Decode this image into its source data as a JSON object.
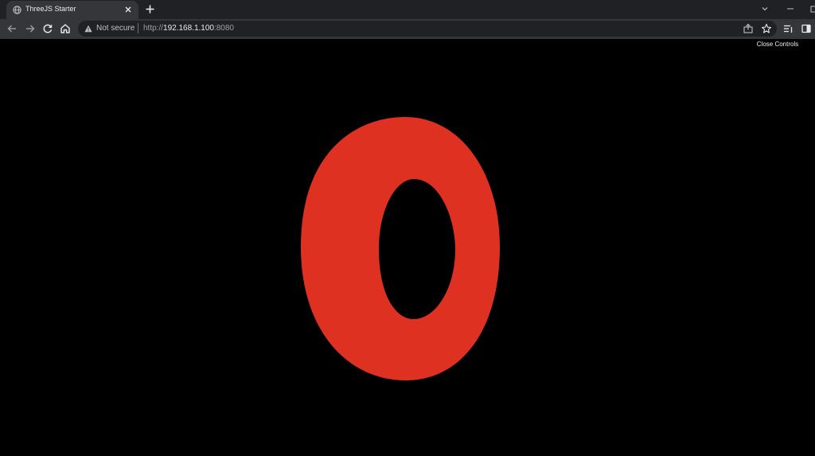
{
  "browser": {
    "tab": {
      "title": "ThreeJS Starter",
      "favicon": "globe-icon"
    },
    "address_bar": {
      "security_label": "Not secure",
      "url_scheme": "http://",
      "url_host": "192.168.1.100",
      "url_port": ":8080"
    },
    "icons": {
      "back": "back-arrow-icon",
      "forward": "forward-arrow-icon",
      "reload": "reload-icon",
      "home": "home-icon",
      "share": "share-icon",
      "bookmark": "star-icon",
      "reading_list": "reading-list-icon",
      "side_panel": "side-panel-icon",
      "tab_search": "chevron-down-icon",
      "minimize": "minimize-icon"
    }
  },
  "page": {
    "gui": {
      "close_controls_label": "Close Controls"
    },
    "scene": {
      "object": "torus",
      "object_color": "#de3122",
      "background_color": "#000000"
    }
  }
}
